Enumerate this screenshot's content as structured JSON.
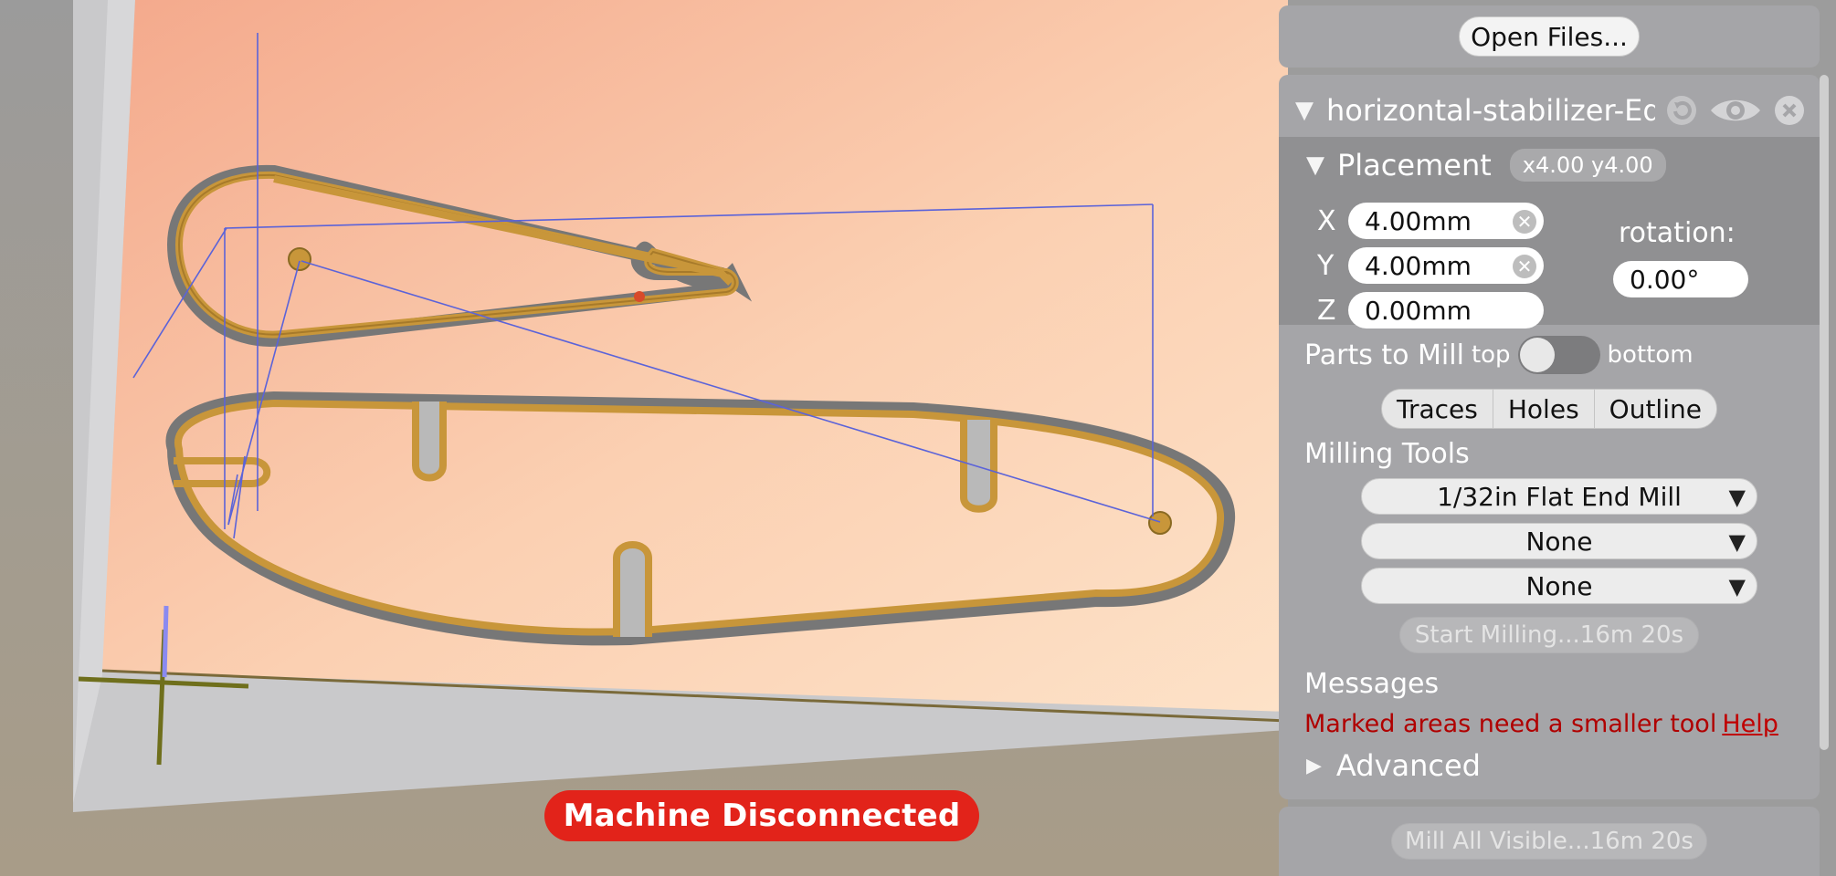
{
  "viewport": {
    "status_badge": "Machine Disconnected"
  },
  "toolbar": {
    "open_files_label": "Open Files..."
  },
  "file": {
    "name": "horizontal-stabilizer-Edge",
    "icons": [
      "refresh-icon",
      "eye-icon",
      "close-icon"
    ]
  },
  "placement": {
    "title": "Placement",
    "summary": "x4.00 y4.00",
    "x_label": "X",
    "x_value": "4.00mm",
    "y_label": "Y",
    "y_value": "4.00mm",
    "z_label": "Z",
    "z_value": "0.00mm",
    "rotation_label": "rotation:",
    "rotation_value": "0.00°"
  },
  "parts_to_mill": {
    "label": "Parts to Mill",
    "top_label": "top",
    "bottom_label": "bottom",
    "tabs": [
      "Traces",
      "Holes",
      "Outline"
    ]
  },
  "milling_tools": {
    "title": "Milling Tools",
    "tool1": "1/32in Flat End Mill",
    "tool2": "None",
    "tool3": "None",
    "start_label": "Start Milling...16m 20s"
  },
  "messages": {
    "title": "Messages",
    "text": "Marked areas need a smaller tool",
    "help_link": "Help"
  },
  "advanced": {
    "label": "Advanced"
  },
  "mill_all": {
    "label": "Mill All Visible...16m 20s"
  },
  "colors": {
    "status_red": "#e2231a",
    "panel_bg": "#a5a5a8",
    "path_gold": "#c8963a",
    "warning_text": "#b00000"
  }
}
